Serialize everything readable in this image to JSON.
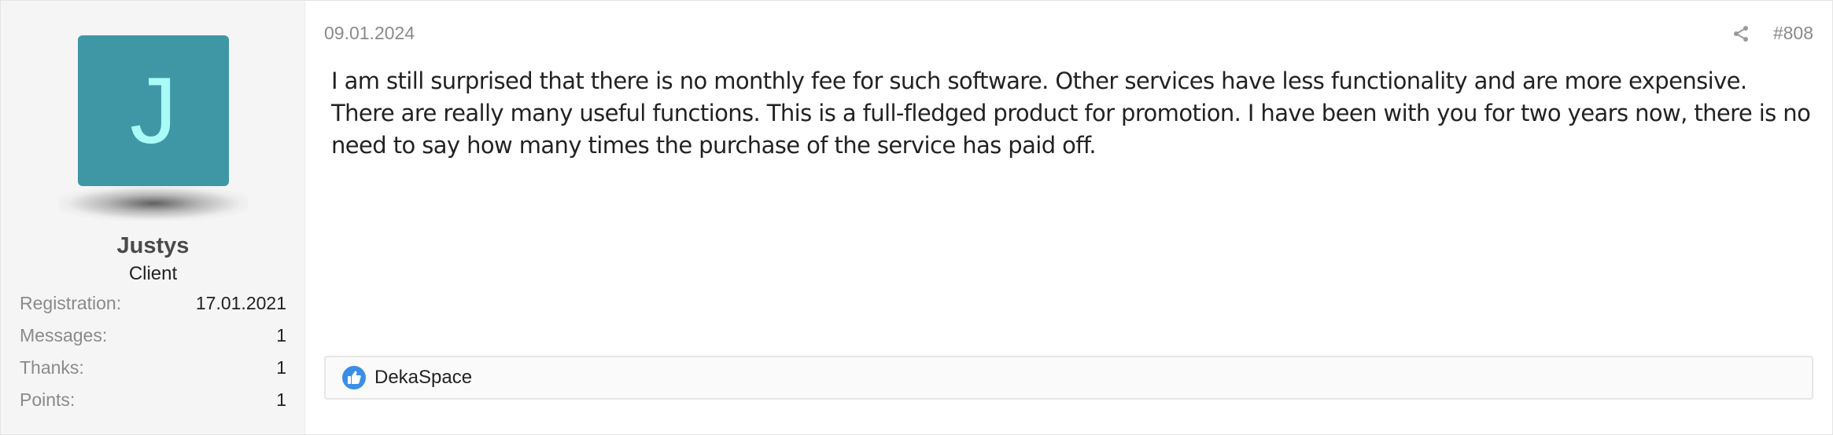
{
  "post": {
    "date": "09.01.2024",
    "number": "#808",
    "body": "I am still surprised that there is no monthly fee for such software. Other services have less functionality and are more expensive. There are really many useful functions. This is a full-fledged product for promotion. I have been with you for two years now, there is no need to say how many times the purchase of the service has paid off.",
    "share_icon": "share-icon"
  },
  "user": {
    "avatar_letter": "J",
    "avatar_bg": "#3f97a6",
    "avatar_fg": "#a9fbf7",
    "name": "Justys",
    "title": "Client",
    "stats": [
      {
        "label": "Registration:",
        "value": "17.01.2021"
      },
      {
        "label": "Messages:",
        "value": "1"
      },
      {
        "label": "Thanks:",
        "value": "1"
      },
      {
        "label": "Points:",
        "value": "1"
      }
    ]
  },
  "reactions": {
    "icon": "thumbs-up-icon",
    "icon_color": "#3a8ee6",
    "users": "DekaSpace"
  }
}
